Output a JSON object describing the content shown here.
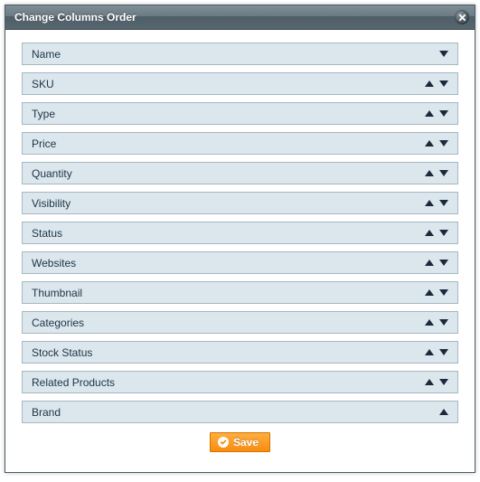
{
  "dialog": {
    "title": "Change Columns Order"
  },
  "columns": [
    {
      "label": "Name",
      "canMoveUp": false,
      "canMoveDown": true
    },
    {
      "label": "SKU",
      "canMoveUp": true,
      "canMoveDown": true
    },
    {
      "label": "Type",
      "canMoveUp": true,
      "canMoveDown": true
    },
    {
      "label": "Price",
      "canMoveUp": true,
      "canMoveDown": true
    },
    {
      "label": "Quantity",
      "canMoveUp": true,
      "canMoveDown": true
    },
    {
      "label": "Visibility",
      "canMoveUp": true,
      "canMoveDown": true
    },
    {
      "label": "Status",
      "canMoveUp": true,
      "canMoveDown": true
    },
    {
      "label": "Websites",
      "canMoveUp": true,
      "canMoveDown": true
    },
    {
      "label": "Thumbnail",
      "canMoveUp": true,
      "canMoveDown": true
    },
    {
      "label": "Categories",
      "canMoveUp": true,
      "canMoveDown": true
    },
    {
      "label": "Stock Status",
      "canMoveUp": true,
      "canMoveDown": true
    },
    {
      "label": "Related Products",
      "canMoveUp": true,
      "canMoveDown": true
    },
    {
      "label": "Brand",
      "canMoveUp": true,
      "canMoveDown": false
    }
  ],
  "buttons": {
    "save": "Save"
  }
}
